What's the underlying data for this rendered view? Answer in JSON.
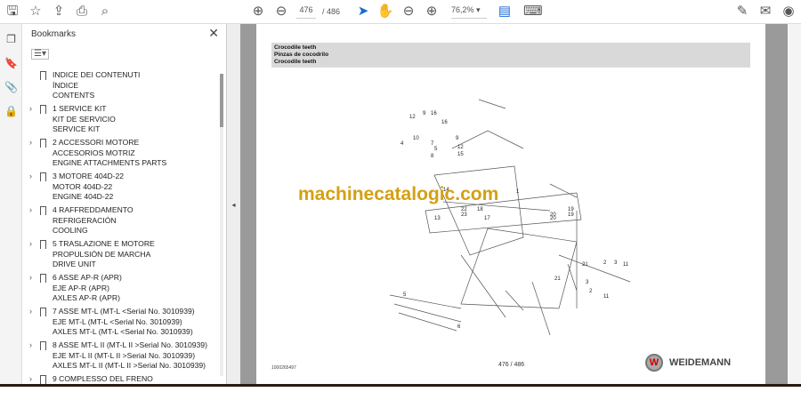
{
  "toolbar": {
    "page_current": "476",
    "page_total": "/ 486",
    "zoom": "76,2%"
  },
  "bookmarks": {
    "title": "Bookmarks",
    "items": [
      {
        "lines": [
          "INDICE DEI CONTENUTI",
          "ÍNDICE",
          "CONTENTS"
        ],
        "expandable": false
      },
      {
        "lines": [
          "1 SERVICE KIT",
          "KIT DE SERVICIO",
          "SERVICE KIT"
        ],
        "expandable": true
      },
      {
        "lines": [
          "2 ACCESSORI MOTORE",
          "ACCESORIOS MOTRIZ",
          "ENGINE ATTACHMENTS PARTS"
        ],
        "expandable": true
      },
      {
        "lines": [
          "3 MOTORE 404D-22",
          "MOTOR 404D-22",
          "ENGINE 404D-22"
        ],
        "expandable": true
      },
      {
        "lines": [
          "4 RAFFREDDAMENTO",
          "REFRIGERACIÓN",
          "COOLING"
        ],
        "expandable": true
      },
      {
        "lines": [
          "5 TRASLAZIONE E MOTORE",
          "PROPULSIÓN DE MARCHA",
          "DRIVE UNIT"
        ],
        "expandable": true
      },
      {
        "lines": [
          "6 ASSE AP-R (APR)",
          "EJE AP-R (APR)",
          "AXLES AP-R (APR)"
        ],
        "expandable": true
      },
      {
        "lines": [
          "7 ASSE MT-L (MT-L <Serial No. 3010939)",
          "EJE MT-L (MT-L <Serial No. 3010939)",
          "AXLES MT-L (MT-L <Serial No. 3010939)"
        ],
        "expandable": true
      },
      {
        "lines": [
          "8 ASSE MT-L II (MT-L II >Serial No. 3010939)",
          "EJE MT-L II (MT-L II >Serial No. 3010939)",
          "AXLES MT-L II (MT-L II >Serial No. 3010939)"
        ],
        "expandable": true
      },
      {
        "lines": [
          "9 COMPLESSO DEL FRENO"
        ],
        "expandable": true
      }
    ]
  },
  "document": {
    "header": [
      "Crocodile teeth",
      "Pinzas de cocodrilo",
      "Crocodile teeth"
    ],
    "watermark": "machinecatalogic.com",
    "footer_code": "1000265497",
    "footer_page": "476 / 486",
    "brand": "WEIDEMANN",
    "brand_logo": "W",
    "callouts": [
      "12",
      "9",
      "16",
      "16",
      "4",
      "10",
      "8",
      "7",
      "9",
      "12",
      "15",
      "5",
      "14",
      "13",
      "22",
      "23",
      "18",
      "17",
      "19",
      "20",
      "19",
      "20",
      "2",
      "3",
      "3",
      "21",
      "21",
      "2",
      "11",
      "11",
      "5",
      "6",
      "1"
    ]
  }
}
